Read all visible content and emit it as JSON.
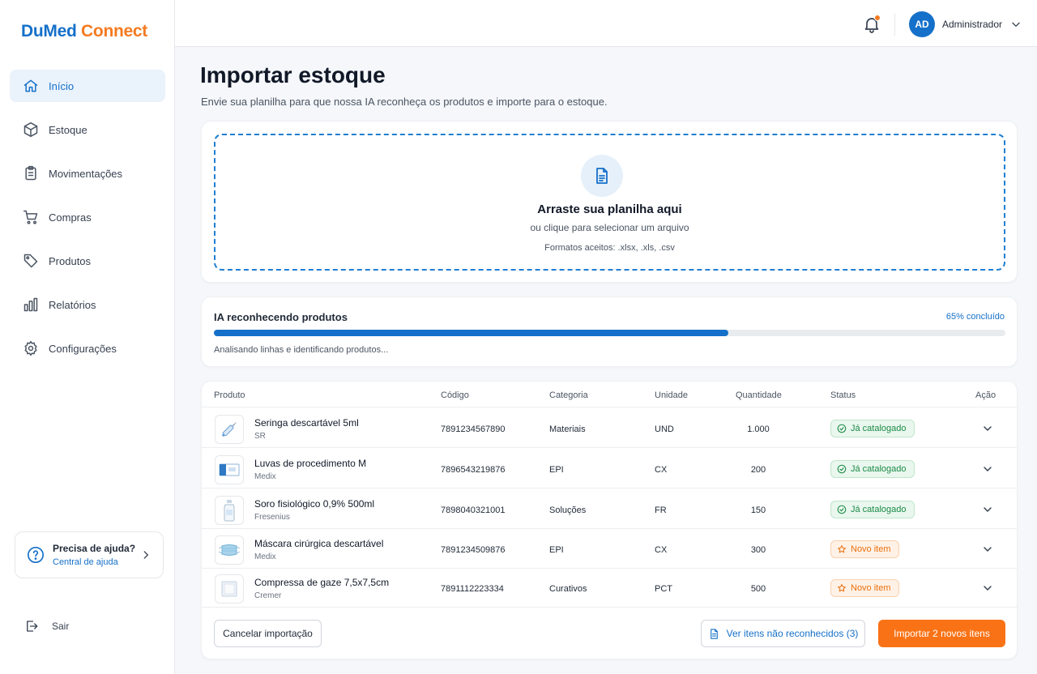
{
  "brand": {
    "part1": "DuMed",
    "part2": "Connect",
    "color_primary": "#1570c9",
    "color_accent": "#f47b20"
  },
  "sidebar": {
    "items": [
      {
        "label": "Início",
        "icon": "home-icon",
        "active": true
      },
      {
        "label": "Estoque",
        "icon": "box-icon"
      },
      {
        "label": "Movimentações",
        "icon": "clipboard-icon"
      },
      {
        "label": "Compras",
        "icon": "cart-icon"
      },
      {
        "label": "Produtos",
        "icon": "tag-icon"
      },
      {
        "label": "Relatórios",
        "icon": "bar-chart-icon"
      },
      {
        "label": "Configurações",
        "icon": "gear-icon"
      }
    ],
    "help": {
      "title": "Precisa de ajuda?",
      "link": "Central de ajuda"
    },
    "logout": "Sair"
  },
  "topbar": {
    "avatar_initials": "AD",
    "user_name": "Administrador",
    "notification": true
  },
  "page": {
    "title": "Importar estoque",
    "subtitle": "Envie sua planilha para que nossa IA reconheça os produtos e importe para o estoque."
  },
  "upload": {
    "title": "Arraste sua planilha aqui",
    "subtitle": "ou clique para selecionar um arquivo",
    "formats": "Formatos aceitos: .xlsx, .xls, .csv"
  },
  "progress": {
    "title": "IA reconhecendo produtos",
    "percent_label": "65% concluído",
    "percent": 0.65,
    "status": "Analisando linhas e identificando produtos..."
  },
  "table": {
    "headers": {
      "product": "Produto",
      "code": "Código",
      "category": "Categoria",
      "unit": "Unidade",
      "quantity": "Quantidade",
      "status": "Status",
      "action": "Ação"
    },
    "rows": [
      {
        "name": "Seringa descartável 5ml",
        "brand": "SR",
        "code": "7891234567890",
        "category": "Materiais",
        "unit": "UND",
        "quantity": "1.000",
        "status": "Já catalogado",
        "status_type": "ok",
        "thumb": "syringe"
      },
      {
        "name": "Luvas de procedimento M",
        "brand": "Medix",
        "code": "7896543219876",
        "category": "EPI",
        "unit": "CX",
        "quantity": "200",
        "status": "Já catalogado",
        "status_type": "ok",
        "thumb": "gloves-box"
      },
      {
        "name": "Soro fisiológico 0,9% 500ml",
        "brand": "Fresenius",
        "code": "7898040321001",
        "category": "Soluções",
        "unit": "FR",
        "quantity": "150",
        "status": "Já catalogado",
        "status_type": "ok",
        "thumb": "saline-bottle"
      },
      {
        "name": "Máscara cirúrgica descartável",
        "brand": "Medix",
        "code": "7891234509876",
        "category": "EPI",
        "unit": "CX",
        "quantity": "300",
        "status": "Novo item",
        "status_type": "new",
        "thumb": "mask"
      },
      {
        "name": "Compressa de gaze 7,5x7,5cm",
        "brand": "Cremer",
        "code": "7891112223334",
        "category": "Curativos",
        "unit": "PCT",
        "quantity": "500",
        "status": "Novo item",
        "status_type": "new",
        "thumb": "gauze"
      }
    ]
  },
  "actions": {
    "cancel": "Cancelar importação",
    "view_unrecognized": "Ver itens não reconhecidos (3)",
    "import": "Importar 2 novos itens",
    "import_color": "#f97316"
  }
}
